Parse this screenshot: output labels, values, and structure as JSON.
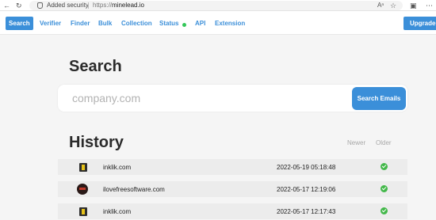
{
  "browser": {
    "security_text": "Added security",
    "url_protocol": "https://",
    "url_host": "minelead.io",
    "icons": [
      "back-icon",
      "refresh-icon",
      "lock-icon",
      "read-aloud-icon",
      "favorites-icon",
      "browser-extension-icon",
      "more-icon"
    ]
  },
  "nav": {
    "items": [
      "Search",
      "Verifier",
      "Finder",
      "Bulk",
      "Collection",
      "Status",
      "API",
      "Extension"
    ],
    "active": "Search",
    "status_color": "#34c759",
    "upgrade": "Upgrade"
  },
  "search": {
    "title": "Search",
    "placeholder": "company.com",
    "button": "Search Emails"
  },
  "history": {
    "title": "History",
    "sort_newer": "Newer",
    "sort_older": "Older",
    "rows": [
      {
        "domain": "inklik.com",
        "timestamp": "2022-05-19 05:18:48",
        "favicon": "inklik-favicon",
        "status": "check-icon"
      },
      {
        "domain": "ilovefreesoftware.com",
        "timestamp": "2022-05-17 12:19:06",
        "favicon": "ilovefreesoftware-favicon",
        "status": "check-icon"
      },
      {
        "domain": "inklik.com",
        "timestamp": "2022-05-17 12:17:43",
        "favicon": "inklik-favicon",
        "status": "check-icon"
      }
    ]
  },
  "colors": {
    "accent": "#3b8fd9",
    "success": "#43b84a",
    "page_bg": "#f5f5f5",
    "row_bg": "#ececec"
  }
}
